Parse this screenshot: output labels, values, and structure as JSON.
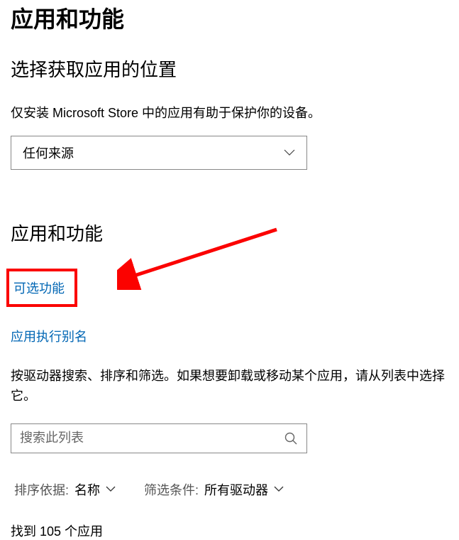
{
  "page_title": "应用和功能",
  "source_section": {
    "heading": "选择获取应用的位置",
    "description": "仅安装 Microsoft Store 中的应用有助于保护你的设备。",
    "select_value": "任何来源"
  },
  "apps_section": {
    "heading": "应用和功能",
    "link_optional_features": "可选功能",
    "link_app_aliases": "应用执行别名",
    "description": "按驱动器搜索、排序和筛选。如果想要卸载或移动某个应用，请从列表中选择它。",
    "search_placeholder": "搜索此列表"
  },
  "filters": {
    "sort_label": "排序依据:",
    "sort_value": "名称",
    "filter_label": "筛选条件:",
    "filter_value": "所有驱动器"
  },
  "count_text": "找到 105 个应用",
  "colors": {
    "link": "#0066b4",
    "highlight": "#fb0200"
  }
}
